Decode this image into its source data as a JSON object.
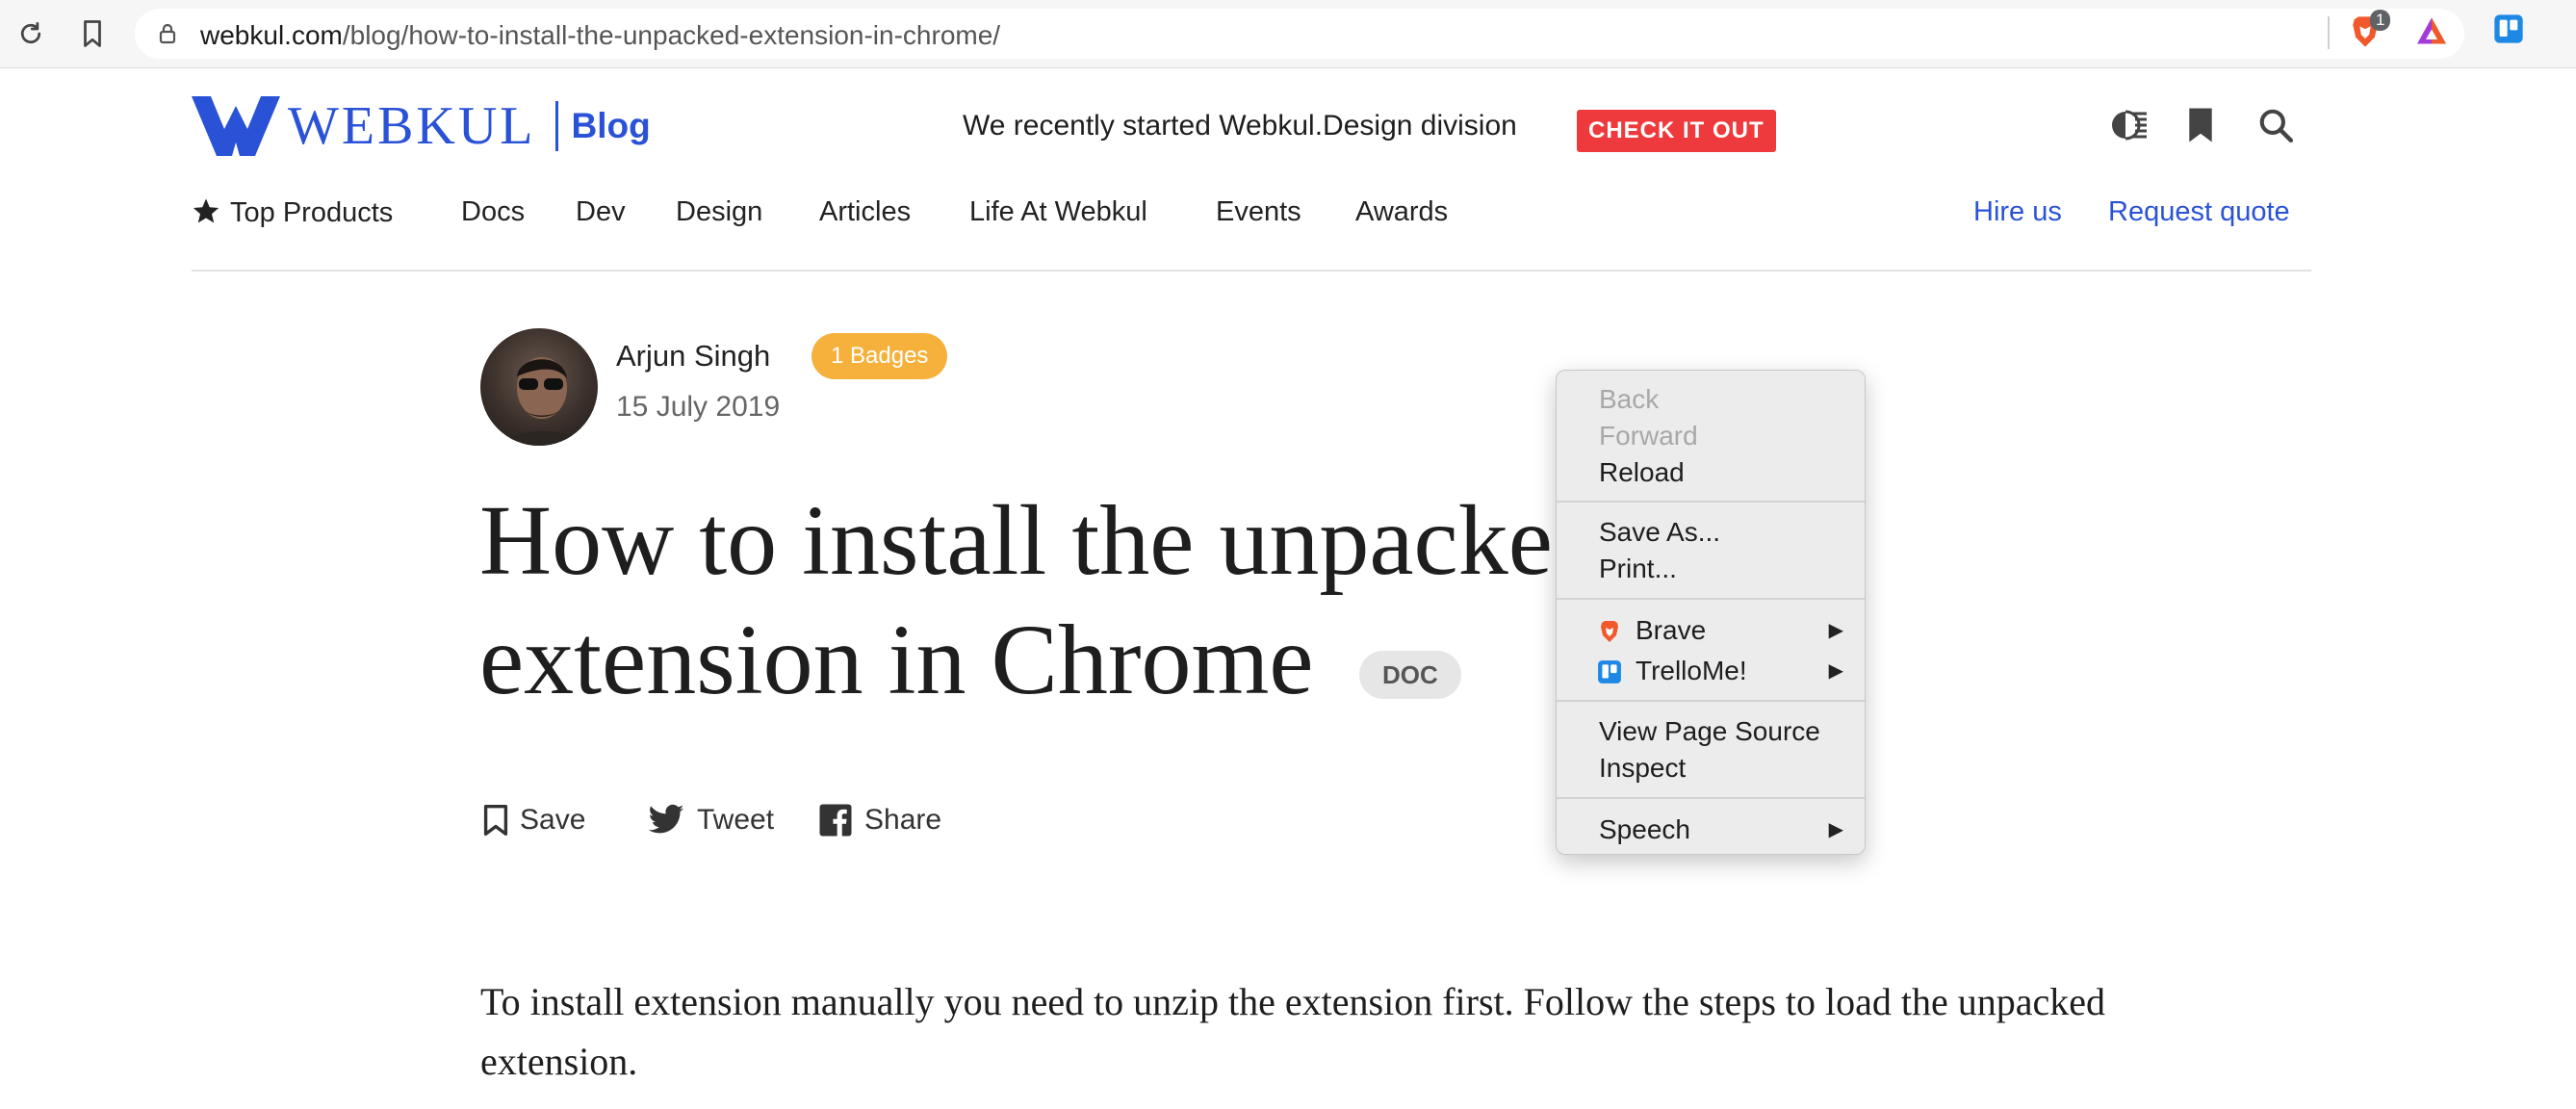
{
  "browser": {
    "url_host": "webkul.com",
    "url_path": "/blog/how-to-install-the-unpacked-extension-in-chrome/",
    "brave_badge": "1"
  },
  "header": {
    "logo_text": "WEBKUL",
    "logo_blog": "Blog",
    "promo_text": "We recently started Webkul.Design division",
    "promo_button": "CHECK IT OUT"
  },
  "nav": {
    "items": [
      "Top Products",
      "Docs",
      "Dev",
      "Design",
      "Articles",
      "Life At Webkul",
      "Events",
      "Awards"
    ],
    "hire": "Hire us",
    "quote": "Request quote"
  },
  "author": {
    "name": "Arjun Singh",
    "badge": "1 Badges",
    "date": "15 July 2019"
  },
  "article": {
    "title_line1": "How to install the unpacked",
    "title_line2": "extension in Chrome",
    "tag": "DOC",
    "share": {
      "save": "Save",
      "tweet": "Tweet",
      "share": "Share"
    },
    "intro": "To install extension manually you need to unzip the extension first. Follow the steps to load the unpacked extension."
  },
  "context_menu": {
    "back": "Back",
    "forward": "Forward",
    "reload": "Reload",
    "save_as": "Save As...",
    "print": "Print...",
    "brave": "Brave",
    "trellome": "TrelloMe!",
    "view_source": "View Page Source",
    "inspect": "Inspect",
    "speech": "Speech"
  },
  "colors": {
    "brand_blue": "#2a52d6",
    "promo_red": "#ee3a3c",
    "badge_orange": "#f5b13c"
  }
}
